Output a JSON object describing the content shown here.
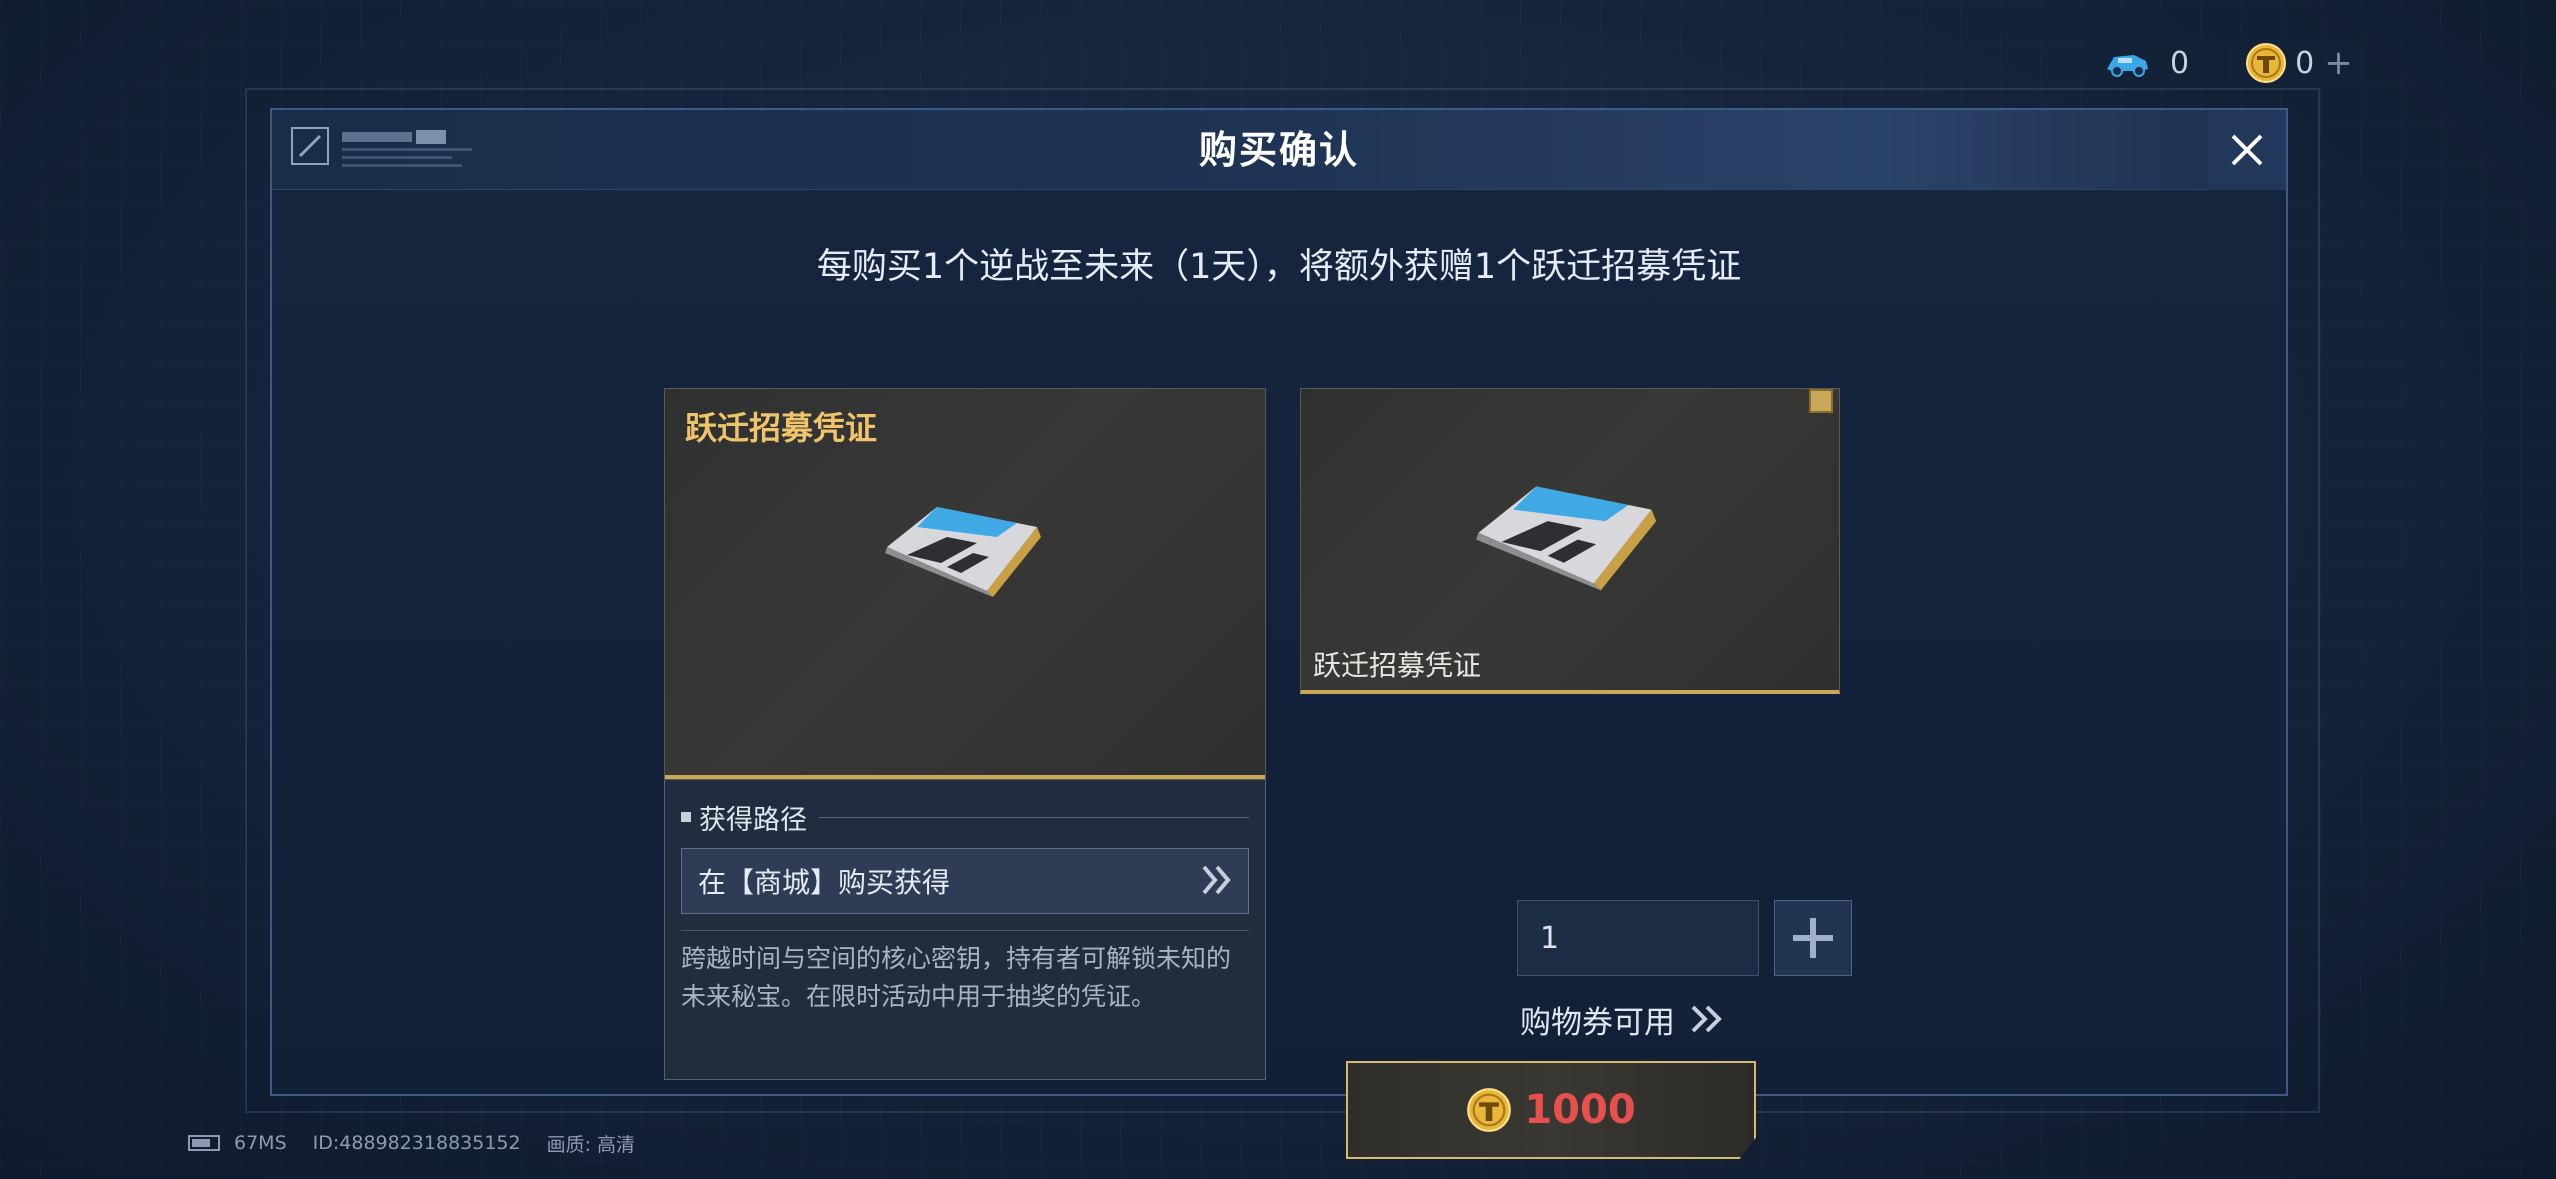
{
  "currency": {
    "vehicle_count": "0",
    "coin_count": "0",
    "plus": "+"
  },
  "dialog": {
    "title": "购买确认",
    "subtitle": "每购买1个逆战至未来（1天），将额外获赠1个跃迁招募凭证"
  },
  "item_card": {
    "name": "跃迁招募凭证"
  },
  "gift_card": {
    "name": "跃迁招募凭证"
  },
  "tooltip": {
    "path_label": "获得路径",
    "path_button": "在【商城】购买获得",
    "description": "跨越时间与空间的核心密钥，持有者可解锁未知的未来秘宝。在限时活动中用于抽奖的凭证。"
  },
  "quantity": {
    "value": "1"
  },
  "coupon": {
    "label": "购物券可用"
  },
  "price": {
    "amount": "1000"
  },
  "status": {
    "ping": "67MS",
    "id": "ID:488982318835152",
    "quality": "画质:  高清"
  },
  "colors": {
    "gold": "#c9a85a",
    "price_red": "#e8504d",
    "item_name_gold": "#f0c46a"
  }
}
